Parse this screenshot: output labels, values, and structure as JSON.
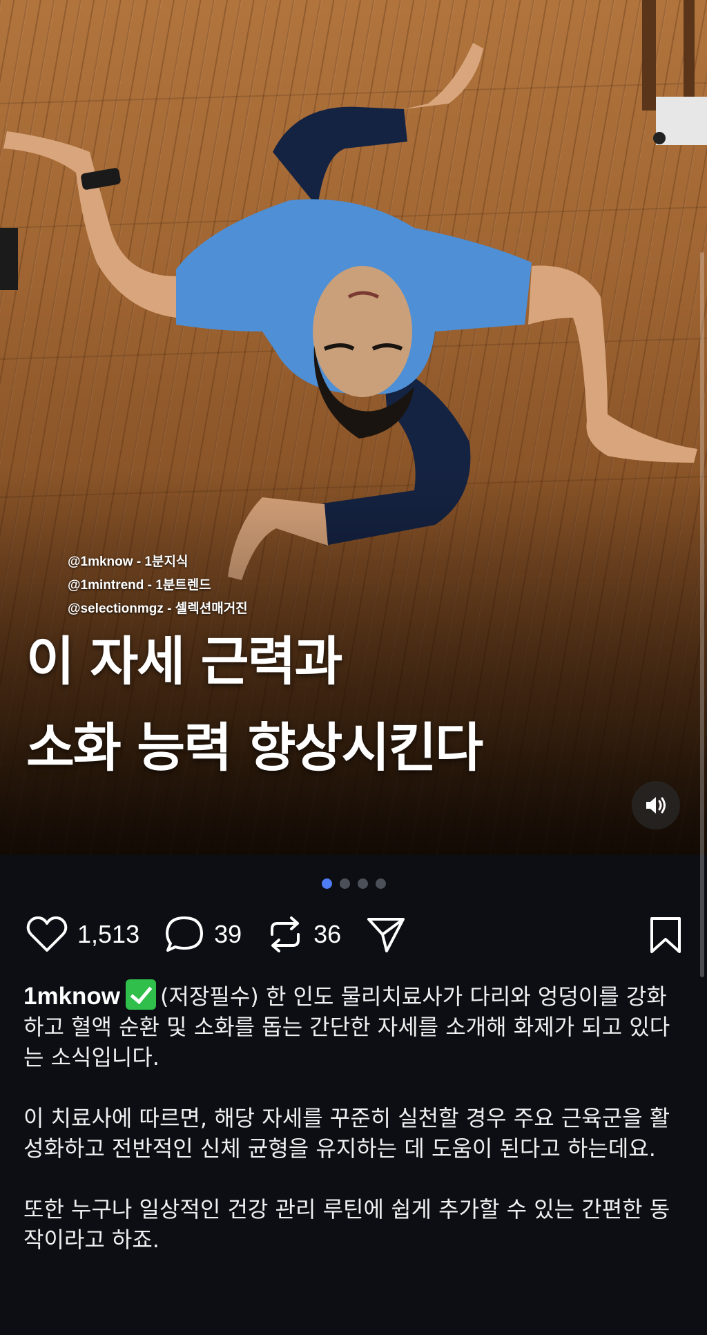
{
  "post": {
    "credits": [
      "@1mknow - 1분지식",
      "@1mintrend - 1분트렌드",
      "@selectionmgz - 셀렉션매거진"
    ],
    "headline": [
      "이 자세 근력과",
      "소화 능력 향상시킨다"
    ],
    "carousel": {
      "total": 4,
      "active": 1
    }
  },
  "actions": {
    "likes": "1,513",
    "comments": "39",
    "reposts": "36"
  },
  "caption": {
    "username": "1mknow",
    "paragraphs": [
      "(저장필수) 한 인도 물리치료사가 다리와 엉덩이를 강화하고 혈액 순환 및 소화를 돕는 간단한 자세를 소개해 화제가 되고 있다는 소식입니다.",
      "이 치료사에 따르면, 해당 자세를 꾸준히 실천할 경우 주요 근육군을 활성화하고 전반적인 신체 균형을 유지하는 데 도움이 된다고 하는데요.",
      "또한 누구나 일상적인 건강 관리 루틴에 쉽게 추가할 수 있는 간편한 동작이라고 하죠."
    ]
  },
  "icons": {
    "like": "heart-icon",
    "comment": "comment-bubble-icon",
    "repost": "repost-icon",
    "share": "send-icon",
    "save": "bookmark-icon",
    "sound": "speaker-icon",
    "verified": "check-badge-icon"
  },
  "colors": {
    "background": "#0c0e14",
    "carousel_active": "#4f7df5",
    "verified_badge": "#2fbf4a"
  }
}
